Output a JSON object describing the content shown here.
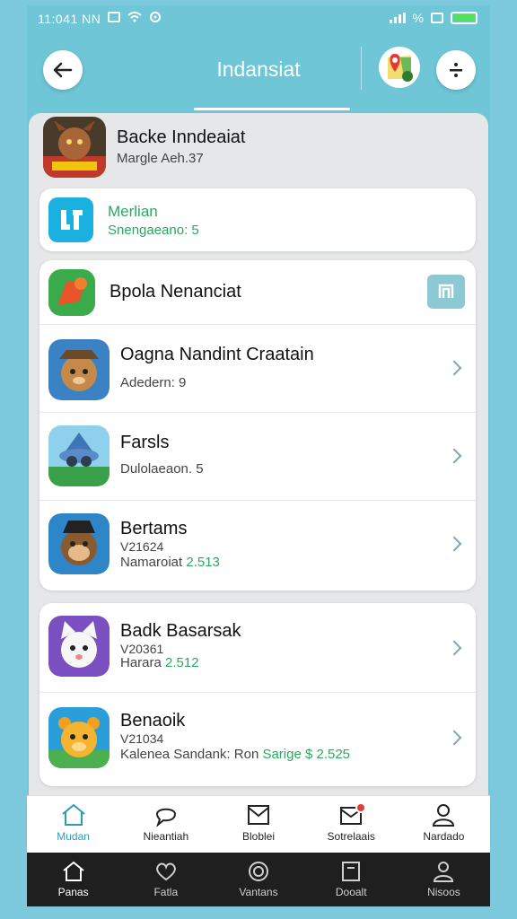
{
  "status": {
    "time": "11:041 NN",
    "battery_label": "%"
  },
  "header": {
    "title": "Indansiat"
  },
  "top_item": {
    "name": "Backe Inndeaiat",
    "subtitle": "Margle Aeh.37"
  },
  "single_card": {
    "name": "Merlian",
    "subtitle": "Snengaeano: 5"
  },
  "group1": [
    {
      "name": "Bpola Nenanciat",
      "has_action": true
    },
    {
      "name": "Oagna Nandint Craatain",
      "line2": "Adedern: 9"
    },
    {
      "name": "Farsls",
      "line2": "Dulolaeaon. 5"
    },
    {
      "name": "Bertams",
      "line2": "V21624",
      "line3_prefix": "Namaroiat ",
      "line3_green": "2.513"
    }
  ],
  "group2": [
    {
      "name": "Badk Basarsak",
      "line2": "V20361",
      "line3_prefix": "Harara ",
      "line3_green": "2.512"
    },
    {
      "name": "Benaoik",
      "line2": "V21034",
      "line3_prefix": "Kalenea Sandank: Ron ",
      "line3_green": "Sarige $ 2.525"
    }
  ],
  "bottom_nav": [
    {
      "label": "Mudan",
      "icon": "home-icon",
      "active": true
    },
    {
      "label": "Nieantiah",
      "icon": "chat-icon",
      "active": false
    },
    {
      "label": "Bloblei",
      "icon": "mail-icon",
      "active": false
    },
    {
      "label": "Sotrelaais",
      "icon": "mail-notify-icon",
      "active": false
    },
    {
      "label": "Nardado",
      "icon": "person-icon",
      "active": false
    }
  ],
  "system_nav": [
    {
      "label": "Panas",
      "icon": "home-icon",
      "active": true
    },
    {
      "label": "Fatla",
      "icon": "heart-icon",
      "active": false
    },
    {
      "label": "Vantans",
      "icon": "target-icon",
      "active": false
    },
    {
      "label": "Dooalt",
      "icon": "square-icon",
      "active": false
    },
    {
      "label": "Nisoos",
      "icon": "person-icon",
      "active": false
    }
  ],
  "colors": {
    "accent": "#6ec6d6",
    "green": "#2aa860",
    "badge": "#e23b3b"
  }
}
